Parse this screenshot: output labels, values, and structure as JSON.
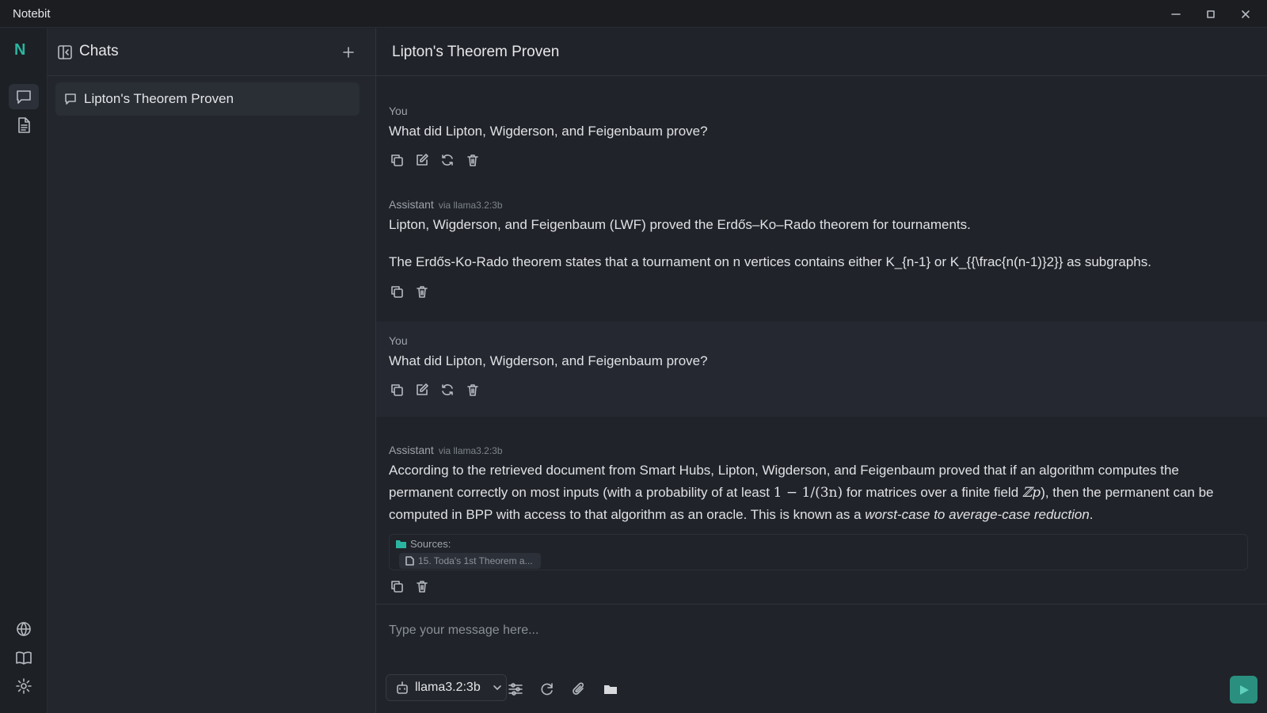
{
  "app": {
    "title": "Notebit",
    "logo": "N"
  },
  "sidebar": {
    "title": "Chats",
    "chats": [
      {
        "label": "Lipton's Theorem Proven",
        "selected": true
      }
    ]
  },
  "main": {
    "title": "Lipton's Theorem Proven"
  },
  "messages": [
    {
      "role": "You",
      "text": "What did Lipton, Wigderson, and Feigenbaum prove?"
    },
    {
      "role": "Assistant",
      "via": "via llama3.2:3b",
      "p1": "Lipton, Wigderson, and Feigenbaum (LWF) proved the Erdős–Ko–Rado theorem for tournaments.",
      "p2": "The Erdős-Ko-Rado theorem states that a tournament on n vertices contains either K_{n-1} or K_{{\\frac{n(n-1)}2}} as subgraphs."
    },
    {
      "role": "You",
      "text": "What did Lipton, Wigderson, and Feigenbaum prove?"
    },
    {
      "role": "Assistant",
      "via": "via llama3.2:3b",
      "t1": "According to the retrieved document from Smart Hubs, Lipton, Wigderson, and Feigenbaum proved that if an algorithm computes the permanent correctly on most inputs (with a probability of at least ",
      "math1": "1 − 1/(3n)",
      "t2": " for matrices over a finite field ",
      "math2": "ℤp",
      "t3": "), then the permanent can be computed in BPP with access to that algorithm as an oracle. This is known as a ",
      "em": "worst-case to average-case reduction",
      "t4": ".",
      "sources_label": "Sources:",
      "source": "15. Toda's 1st Theorem a..."
    }
  ],
  "composer": {
    "placeholder": "Type your message here...",
    "model": "llama3.2:3b"
  },
  "colors": {
    "accent": "#2bb5a0",
    "send": "#2a8f7f",
    "background": "#202329"
  },
  "icons": [
    "chat-icon",
    "document-icon",
    "globe-icon",
    "book-icon",
    "gear-icon",
    "copy-icon",
    "edit-icon",
    "regenerate-icon",
    "trash-icon",
    "folder-icon",
    "attach-icon",
    "sliders-icon",
    "send-icon",
    "robot-icon"
  ]
}
